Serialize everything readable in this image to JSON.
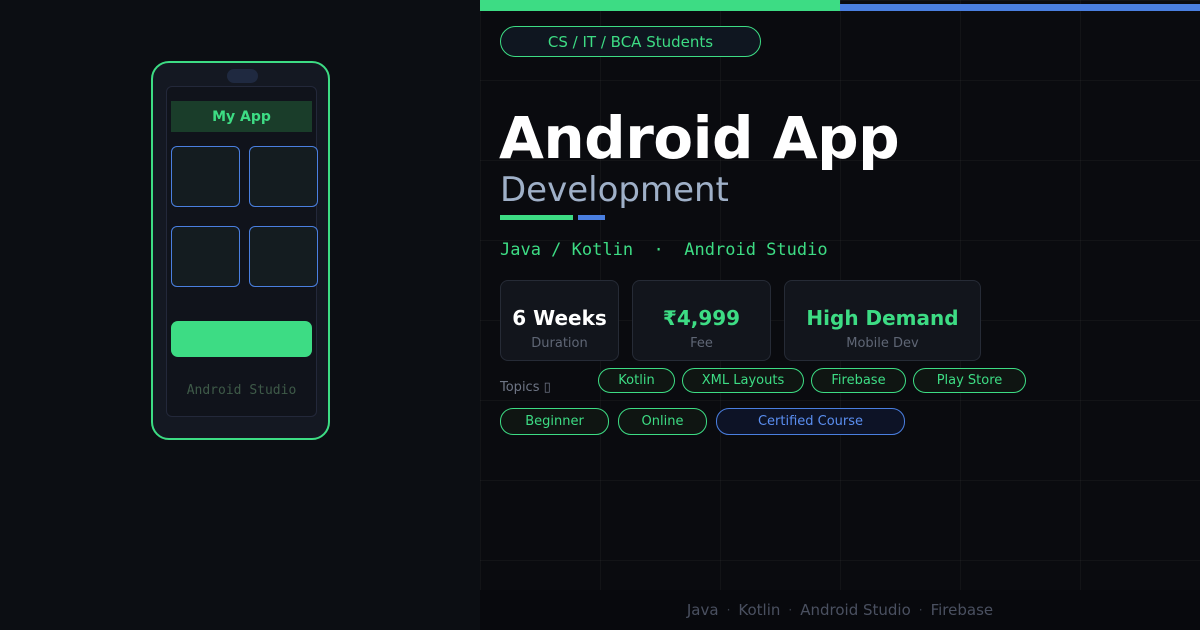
{
  "phone": {
    "app_title": "My App",
    "caption": "Android Studio"
  },
  "header": {
    "audience": "CS / IT / BCA Students",
    "title": "Android App",
    "subtitle": "Development",
    "tech": [
      "Java / Kotlin",
      "Android Studio"
    ],
    "tech_separator": "·"
  },
  "stats": [
    {
      "value": "6 Weeks",
      "label": "Duration",
      "color": "#ffffff"
    },
    {
      "value": "₹4,999",
      "label": "Fee",
      "color": "#3ddc84"
    },
    {
      "value": "High Demand",
      "label": "Mobile Dev",
      "color": "#3ddc84"
    }
  ],
  "topics": {
    "label": "Topics ",
    "label_icon": "arrow-icon",
    "items": [
      "Kotlin",
      "XML Layouts",
      "Firebase",
      "Play Store"
    ]
  },
  "tags": [
    "Beginner",
    "Online",
    "Certified Course"
  ],
  "footer": {
    "items": [
      "Java",
      "Kotlin",
      "Android Studio",
      "Firebase"
    ],
    "separator": "·"
  },
  "colors": {
    "accent_green": "#3ddc84",
    "accent_blue": "#4a7fe0",
    "background": "#0c0e13"
  }
}
